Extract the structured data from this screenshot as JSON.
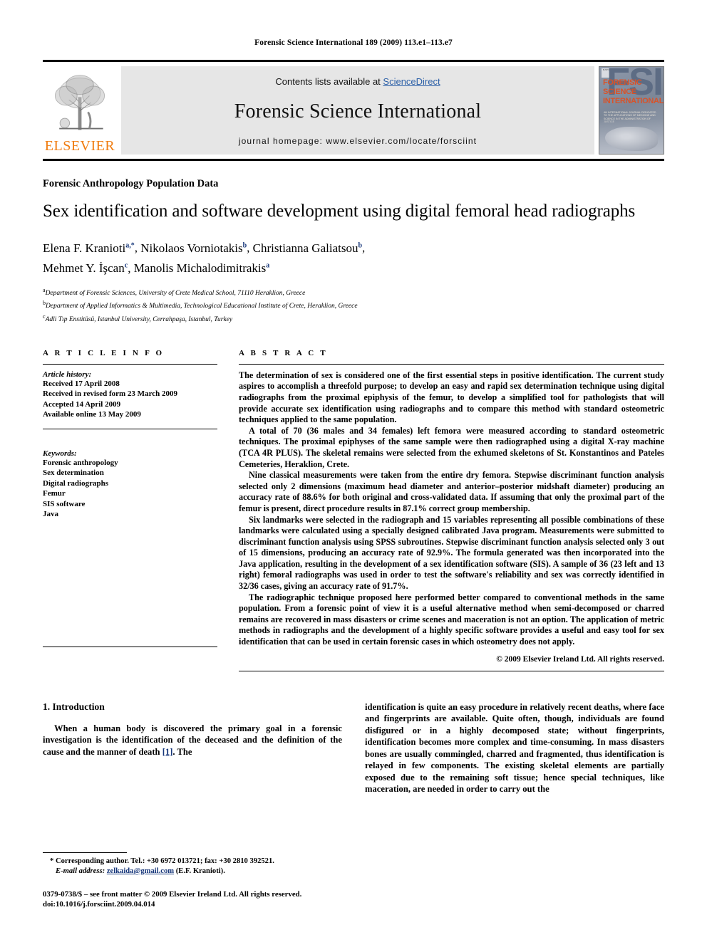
{
  "running_head": "Forensic Science International 189 (2009) 113.e1–113.e7",
  "masthead": {
    "contents_prefix": "Contents lists available at ",
    "sciencedirect": "ScienceDirect",
    "journal_title": "Forensic Science International",
    "homepage": "journal homepage: www.elsevier.com/locate/forsciint",
    "publisher_wordmark": "ELSEVIER",
    "publisher_color": "#F07D12",
    "link_color": "#2b5fa7",
    "cover": {
      "big_letters": "FSI",
      "title_lines": [
        "FORENSIC",
        "SCIENCE",
        "INTERNATIONAL"
      ],
      "subtitle": "AN INTERNATIONAL JOURNAL DEDICATED TO THE APPLICATIONS OF MEDICINE AND SCIENCE IN THE ADMINISTRATION OF JUSTICE",
      "corner_label": "ELSEVIER",
      "title_color": "#d8532a"
    }
  },
  "article": {
    "section_label": "Forensic Anthropology Population Data",
    "title": "Sex identification and software development using digital femoral head radiographs",
    "authors": [
      {
        "name": "Elena F. Kranioti",
        "marks": "a,*"
      },
      {
        "name": "Nikolaos Vorniotakis",
        "marks": "b"
      },
      {
        "name": "Christianna Galiatsou",
        "marks": "b"
      },
      {
        "name": "Mehmet Y. İşcan",
        "marks": "c"
      },
      {
        "name": "Manolis Michalodimitrakis",
        "marks": "a"
      }
    ],
    "affiliations": [
      {
        "mark": "a",
        "text": "Department of Forensic Sciences, University of Crete Medical School, 71110 Heraklion, Greece"
      },
      {
        "mark": "b",
        "text": "Department of Applied Informatics & Multimedia, Technological Educational Institute of Crete, Heraklion, Greece"
      },
      {
        "mark": "c",
        "text": "Adli Tıp Enstitüsü, Istanbul University, Cerrahpaşa, Istanbul, Turkey"
      }
    ]
  },
  "article_info": {
    "heading": "A R T I C L E    I N F O",
    "history_label": "Article history:",
    "history": [
      "Received 17 April 2008",
      "Received in revised form 23 March 2009",
      "Accepted 14 April 2009",
      "Available online 13 May 2009"
    ],
    "keywords_label": "Keywords:",
    "keywords": [
      "Forensic anthropology",
      "Sex determination",
      "Digital radiographs",
      "Femur",
      "SIS software",
      "Java"
    ]
  },
  "abstract": {
    "heading": "A B S T R A C T",
    "paragraphs": [
      "The determination of sex is considered one of the first essential steps in positive identification. The current study aspires to accomplish a threefold purpose; to develop an easy and rapid sex determination technique using digital radiographs from the proximal epiphysis of the femur, to develop a simplified tool for pathologists that will provide accurate sex identification using radiographs and to compare this method with standard osteometric techniques applied to the same population.",
      "A total of 70 (36 males and 34 females) left femora were measured according to standard osteometric techniques. The proximal epiphyses of the same sample were then radiographed using a digital X-ray machine (TCA 4R PLUS). The skeletal remains were selected from the exhumed skeletons of St. Konstantinos and Pateles Cemeteries, Heraklion, Crete.",
      "Nine classical measurements were taken from the entire dry femora. Stepwise discriminant function analysis selected only 2 dimensions (maximum head diameter and anterior–posterior midshaft diameter) producing an accuracy rate of 88.6% for both original and cross-validated data. If assuming that only the proximal part of the femur is present, direct procedure results in 87.1% correct group membership.",
      "Six landmarks were selected in the radiograph and 15 variables representing all possible combinations of these landmarks were calculated using a specially designed calibrated Java program. Measurements were submitted to discriminant function analysis using SPSS subroutines. Stepwise discriminant function analysis selected only 3 out of 15 dimensions, producing an accuracy rate of 92.9%. The formula generated was then incorporated into the Java application, resulting in the development of a sex identification software (SIS). A sample of 36 (23 left and 13 right) femoral radiographs was used in order to test the software's reliability and sex was correctly identified in 32/36 cases, giving an accuracy rate of 91.7%.",
      "The radiographic technique proposed here performed better compared to conventional methods in the same population. From a forensic point of view it is a useful alternative method when semi-decomposed or charred remains are recovered in mass disasters or crime scenes and maceration is not an option. The application of metric methods in radiographs and the development of a highly specific software provides a useful and easy tool for sex identification that can be used in certain forensic cases in which osteometry does not apply."
    ],
    "copyright": "© 2009 Elsevier Ireland Ltd. All rights reserved."
  },
  "introduction": {
    "heading": "1. Introduction",
    "left_text_before_ref": "When a human body is discovered the primary goal in a forensic investigation is the identification of the deceased and the definition of the cause and the manner of death ",
    "reference": "[1]",
    "left_text_after_ref": ". The",
    "right_text": "identification is quite an easy procedure in relatively recent deaths, where face and fingerprints are available. Quite often, though, individuals are found disfigured or in a highly decomposed state; without fingerprints, identification becomes more complex and time-consuming. In mass disasters bones are usually commingled, charred and fragmented, thus identification is relayed in few components. The existing skeletal elements are partially exposed due to the remaining soft tissue; hence special techniques, like maceration, are needed in order to carry out the"
  },
  "footnotes": {
    "corresponding_marker": "*",
    "corresponding": "Corresponding author. Tel.: +30 6972 013721; fax: +30 2810 392521.",
    "email_label": "E-mail address:",
    "email": "zelkaida@gmail.com",
    "email_owner": "(E.F. Kranioti).",
    "imprint_line1": "0379-0738/$ – see front matter © 2009 Elsevier Ireland Ltd. All rights reserved.",
    "imprint_line2": "doi:10.1016/j.forsciint.2009.04.014"
  }
}
